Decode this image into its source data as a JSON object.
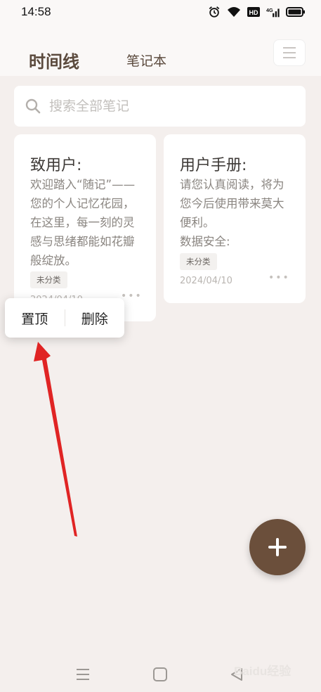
{
  "status_bar": {
    "time": "14:58",
    "icons": [
      "alarm-icon",
      "wifi-icon",
      "hd-icon",
      "signal-4g-icon",
      "battery-icon"
    ]
  },
  "header": {
    "tabs": [
      {
        "label": "时间线",
        "active": true
      },
      {
        "label": "笔记本",
        "active": false
      }
    ],
    "menu_icon": "hamburger-icon"
  },
  "search": {
    "placeholder": "搜索全部笔记",
    "icon": "search-icon"
  },
  "notes": [
    {
      "title": "致用户:",
      "body": "欢迎踏入“随记”——您的个人记忆花园，在这里，每一刻的灵感与思绪都能如花瓣般绽放。",
      "tag": "未分类",
      "date": "2024/04/10"
    },
    {
      "title": "用户手册:",
      "body": "请您认真阅读，将为您今后使用带来莫大便利。\n数据安全:",
      "tag": "未分类",
      "date": "2024/04/10"
    }
  ],
  "context_menu": {
    "items": [
      "置顶",
      "删除"
    ]
  },
  "fab": {
    "icon": "plus-icon"
  },
  "colors": {
    "background": "#f4efed",
    "accent": "#6b4f3b",
    "annotation_arrow": "#e02424"
  },
  "nav_bar": {
    "icons": [
      "recents-icon",
      "home-icon",
      "back-icon"
    ]
  },
  "watermark": "Baidu经验"
}
